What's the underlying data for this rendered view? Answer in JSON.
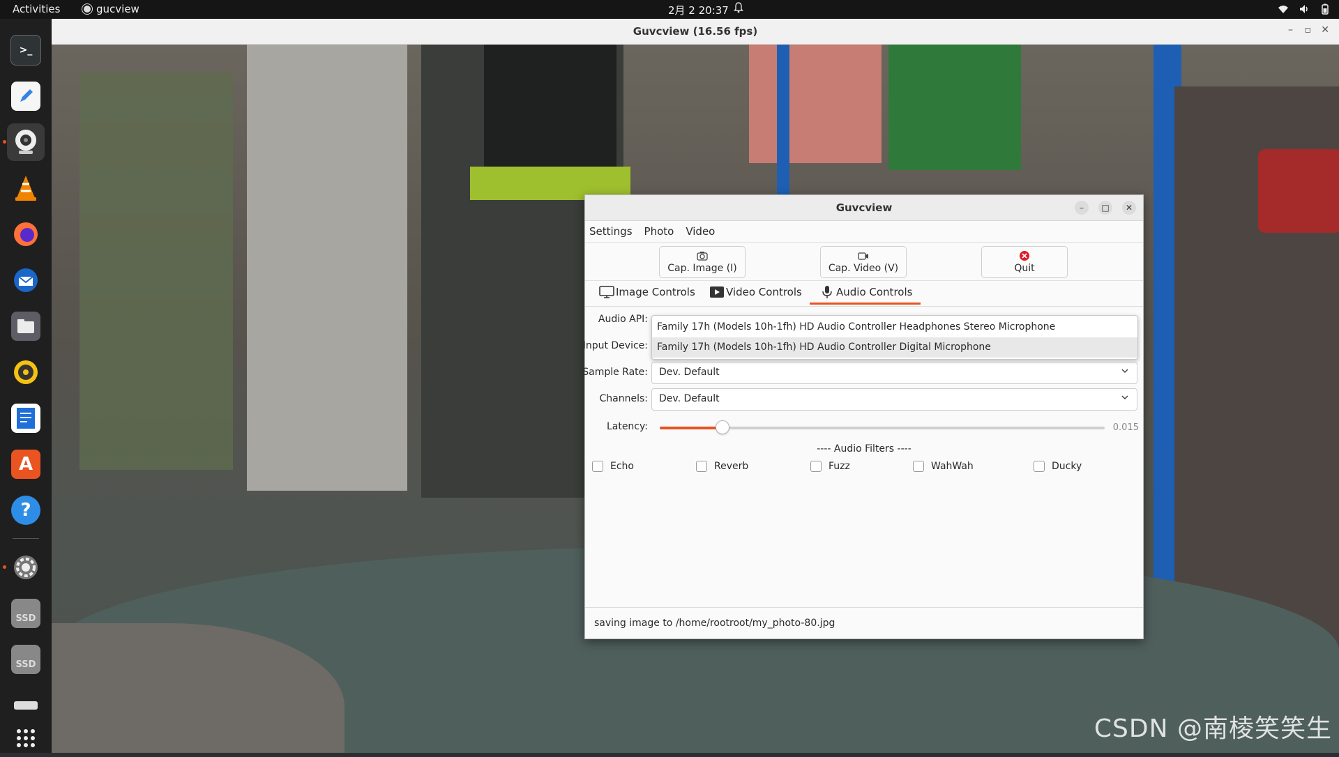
{
  "topbar": {
    "activities": "Activities",
    "app_name": "gucview",
    "clock": "2月 2  20:37"
  },
  "dock": {
    "items": [
      {
        "icon": "terminal-icon"
      },
      {
        "icon": "text-editor-icon"
      },
      {
        "icon": "webcam-icon",
        "active": true
      },
      {
        "icon": "vlc-icon"
      },
      {
        "icon": "firefox-icon"
      },
      {
        "icon": "thunderbird-icon"
      },
      {
        "icon": "files-icon"
      },
      {
        "icon": "rhythmbox-icon"
      },
      {
        "icon": "writer-icon"
      },
      {
        "icon": "app-center-icon"
      },
      {
        "icon": "help-icon"
      },
      {
        "icon": "settings-icon"
      },
      {
        "icon": "ssd-drive-icon",
        "label": "SSD"
      },
      {
        "icon": "ssd-drive-icon",
        "label": "SSD"
      },
      {
        "icon": "drive-icon"
      },
      {
        "icon": "app-grid-icon"
      }
    ]
  },
  "preview_window": {
    "title": "Guvcview  (16.56 fps)"
  },
  "watermark": "CSDN @南棱笑笑生",
  "dialog": {
    "title": "Guvcview",
    "menu": [
      "Settings",
      "Photo",
      "Video"
    ],
    "toolbar": {
      "cap_image": "Cap. Image (I)",
      "cap_video": "Cap. Video (V)",
      "quit": "Quit"
    },
    "tabs": {
      "image": "Image Controls",
      "video": "Video Controls",
      "audio": "Audio Controls",
      "active": "audio"
    },
    "form": {
      "audio_api_label": "Audio API:",
      "input_device_label": "Input Device:",
      "sample_rate_label": "Sample Rate:",
      "sample_rate_value": "Dev. Default",
      "channels_label": "Channels:",
      "channels_value": "Dev. Default",
      "latency_label": "Latency:",
      "latency_value": "0.015",
      "latency_fraction": 0.14
    },
    "dropdown_options": [
      "Family 17h (Models 10h-1fh) HD Audio Controller Headphones Stereo Microphone",
      "Family 17h (Models 10h-1fh) HD Audio Controller Digital Microphone"
    ],
    "filters": {
      "header": "---- Audio Filters ----",
      "items": [
        "Echo",
        "Reverb",
        "Fuzz",
        "WahWah",
        "Ducky"
      ]
    },
    "status": "saving image to /home/rootroot/my_photo-80.jpg"
  },
  "colors": {
    "accent": "#e95420",
    "quit_red": "#e01b24"
  }
}
